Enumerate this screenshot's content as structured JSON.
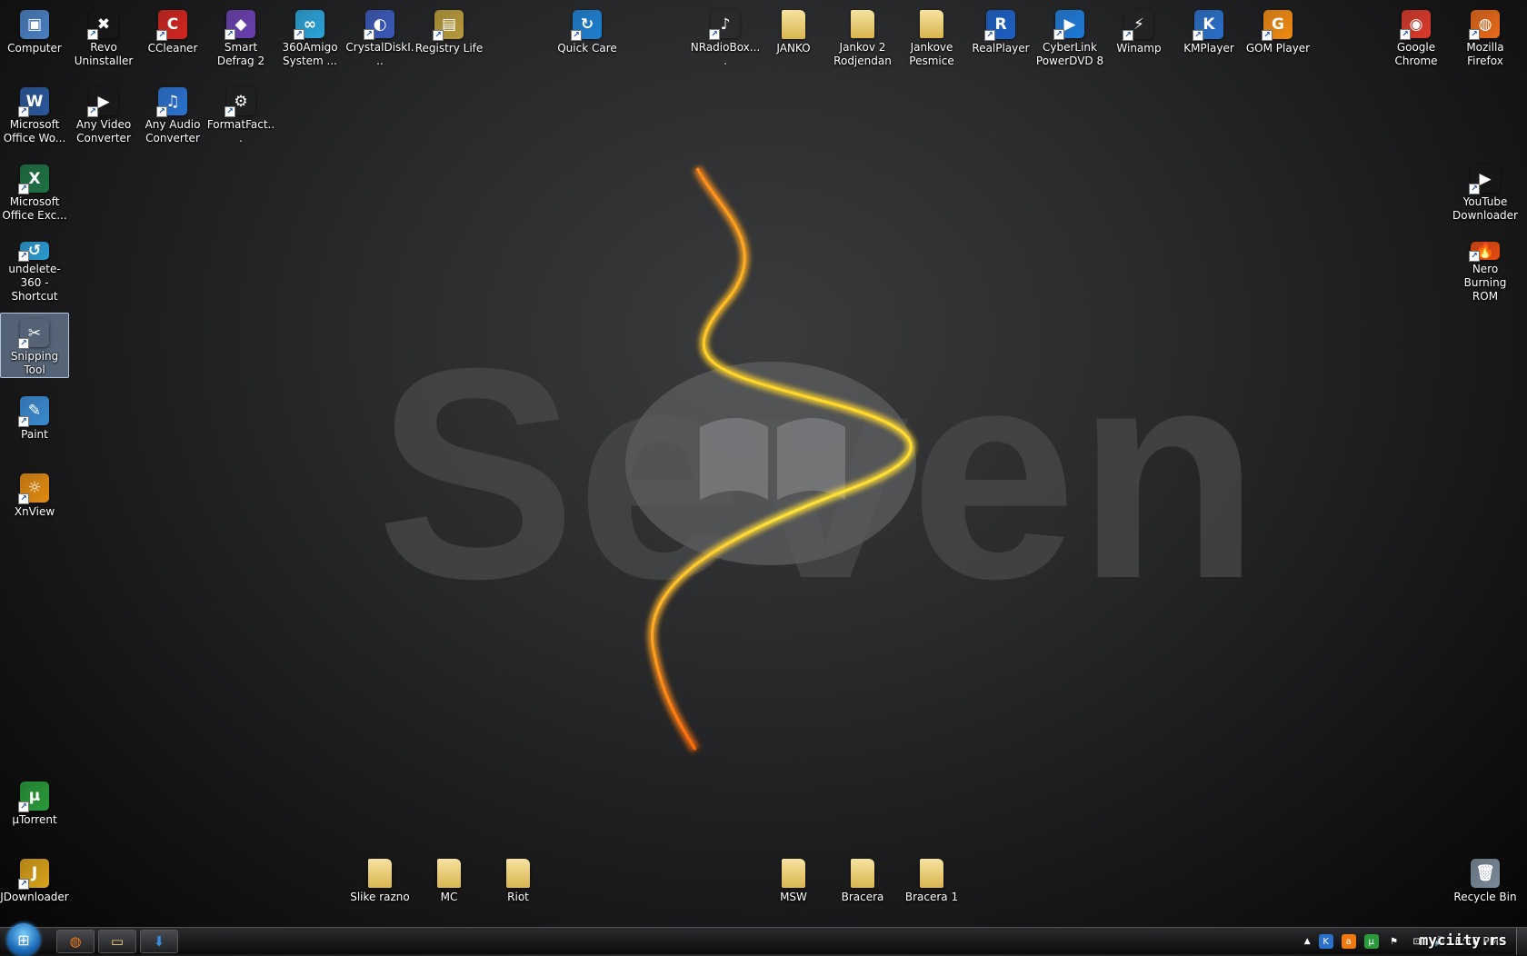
{
  "desktop": {
    "icons": [
      {
        "label": "Computer",
        "icon": "computer-icon",
        "color": "#4a7fc1",
        "glyph": "▣"
      },
      {
        "label": "Revo Uninstaller",
        "icon": "revo-uninstaller-icon",
        "color": "#c33",
        "glyph": "✖"
      },
      {
        "label": "CCleaner",
        "icon": "ccleaner-icon",
        "color": "#d2261f",
        "glyph": "C"
      },
      {
        "label": "Smart Defrag 2",
        "icon": "smart-defrag-icon",
        "color": "#6a3fb0",
        "glyph": "◆"
      },
      {
        "label": "360Amigo System ...",
        "icon": "360amigo-icon",
        "color": "#2aa3d9",
        "glyph": "∞"
      },
      {
        "label": "CrystalDiskI...",
        "icon": "crystaldiskinfo-icon",
        "color": "#3a58b8",
        "glyph": "◐"
      },
      {
        "label": "Registry Life",
        "icon": "registry-life-icon",
        "color": "#b89a3a",
        "glyph": "▤"
      },
      {
        "label": "Quick Care",
        "icon": "quick-care-icon",
        "color": "#1d7fd0",
        "glyph": "↻"
      },
      {
        "label": "NRadioBox....",
        "icon": "nradiobox-icon",
        "color": "#555",
        "glyph": "♪"
      },
      {
        "label": "JANKO",
        "icon": "folder-icon",
        "folder": true
      },
      {
        "label": "Jankov 2 Rodjendan",
        "icon": "folder-icon",
        "folder": true
      },
      {
        "label": "Jankove Pesmice",
        "icon": "folder-icon",
        "folder": true
      },
      {
        "label": "RealPlayer",
        "icon": "realplayer-icon",
        "color": "#1b5fc4",
        "glyph": "R"
      },
      {
        "label": "CyberLink PowerDVD 8",
        "icon": "powerdvd-icon",
        "color": "#1e7ad8",
        "glyph": "▶"
      },
      {
        "label": "Winamp",
        "icon": "winamp-icon",
        "color": "#666",
        "glyph": "⚡"
      },
      {
        "label": "KMPlayer",
        "icon": "kmplayer-icon",
        "color": "#2a6fc8",
        "glyph": "K"
      },
      {
        "label": "GOM Player",
        "icon": "gom-player-icon",
        "color": "#f08a12",
        "glyph": "G"
      },
      {
        "label": "Google Chrome",
        "icon": "chrome-icon",
        "color": "#d93a2b",
        "glyph": "◉"
      },
      {
        "label": "Mozilla Firefox",
        "icon": "firefox-icon",
        "color": "#e66a1a",
        "glyph": "◍"
      },
      {
        "label": "Microsoft Office Wo...",
        "icon": "word-icon",
        "color": "#2b579a",
        "glyph": "W"
      },
      {
        "label": "Any Video Converter",
        "icon": "any-video-converter-icon",
        "color": "#d33",
        "glyph": "▶"
      },
      {
        "label": "Any Audio Converter",
        "icon": "any-audio-converter-icon",
        "color": "#2a72d0",
        "glyph": "♫"
      },
      {
        "label": "FormatFact...",
        "icon": "format-factory-icon",
        "color": "#888",
        "glyph": "⚙"
      },
      {
        "label": "Microsoft Office Exc...",
        "icon": "excel-icon",
        "color": "#1f7244",
        "glyph": "X"
      },
      {
        "label": "undelete-360 - Shortcut",
        "icon": "undelete-360-icon",
        "color": "#2a9ad0",
        "glyph": "↺"
      },
      {
        "label": "Snipping Tool",
        "icon": "snipping-tool-icon",
        "color": "#c44",
        "glyph": "✂",
        "selected": true
      },
      {
        "label": "Paint",
        "icon": "paint-icon",
        "color": "#3a8ad0",
        "glyph": "✎"
      },
      {
        "label": "XnView",
        "icon": "xnview-icon",
        "color": "#e08a10",
        "glyph": "☼"
      },
      {
        "label": "YouTube Downloader",
        "icon": "youtube-downloader-icon",
        "color": "#c22",
        "glyph": "▶"
      },
      {
        "label": "Nero Burning ROM",
        "icon": "nero-icon",
        "color": "#e24a12",
        "glyph": "🔥"
      },
      {
        "label": "µTorrent",
        "icon": "utorrent-icon",
        "color": "#2a9a3a",
        "glyph": "µ"
      },
      {
        "label": "JDownloader",
        "icon": "jdownloader-icon",
        "color": "#d9a21a",
        "glyph": "J"
      },
      {
        "label": "Slike razno",
        "icon": "folder-icon",
        "folder": true
      },
      {
        "label": "MC",
        "icon": "folder-icon",
        "folder": true
      },
      {
        "label": "Riot",
        "icon": "folder-icon",
        "folder": true
      },
      {
        "label": "MSW",
        "icon": "folder-icon",
        "folder": true
      },
      {
        "label": "Bracera",
        "icon": "folder-icon",
        "folder": true
      },
      {
        "label": "Bracera 1",
        "icon": "folder-icon",
        "folder": true
      },
      {
        "label": "Recycle Bin",
        "icon": "recycle-bin-icon",
        "color": "#7a8a99",
        "glyph": "🗑"
      }
    ],
    "wallpaper_text": "Seven"
  },
  "taskbar": {
    "pinned": [
      {
        "name": "firefox",
        "glyph": "◍",
        "color": "#f07a1a"
      },
      {
        "name": "windows-explorer",
        "glyph": "▭",
        "color": "#f3d57a"
      },
      {
        "name": "download-manager",
        "glyph": "⬇",
        "color": "#3a8ae0"
      }
    ],
    "tray": [
      {
        "name": "kmplayer-tray",
        "glyph": "K",
        "color": "#2a6fc8"
      },
      {
        "name": "avast-tray",
        "glyph": "a",
        "color": "#f07a12"
      },
      {
        "name": "utorrent-tray",
        "glyph": "µ",
        "color": "#2a9a3a"
      },
      {
        "name": "action-center-flag",
        "glyph": "⚑",
        "color": "transparent"
      },
      {
        "name": "network",
        "glyph": "⊡",
        "color": "transparent"
      },
      {
        "name": "volume",
        "glyph": "🔊",
        "color": "transparent"
      }
    ],
    "clock": "6:10 PM",
    "watermark": "myciity.rs"
  }
}
